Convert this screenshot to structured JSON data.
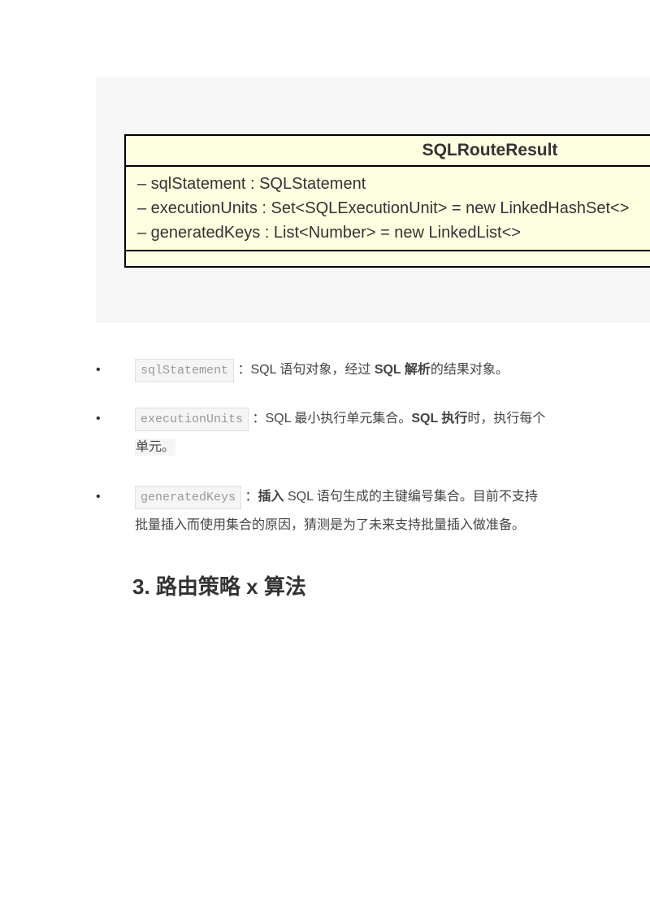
{
  "uml": {
    "className": "SQLRouteResult",
    "fields": [
      "– sqlStatement : SQLStatement",
      "– executionUnits : Set<SQLExecutionUnit> = new LinkedHashSet<>",
      "– generatedKeys : List<Number> = new LinkedList<>"
    ]
  },
  "items": [
    {
      "code": "sqlStatement",
      "text_before_bold": "：SQL 语句对象，经过 ",
      "bold": "SQL 解析",
      "text_after_bold": "的结果对象。",
      "continuation": ""
    },
    {
      "code": "executionUnits",
      "text_before_bold": "：SQL 最小执行单元集合。",
      "bold": "SQL 执行",
      "text_after_bold": "时，执行每个",
      "continuation": "单元。"
    },
    {
      "code": "generatedKeys",
      "text_before_bold": "：",
      "bold": "插入 ",
      "text_after_bold": "SQL 语句生成的主键编号集合。目前不支持",
      "continuation": "批量插入而使用集合的原因，猜测是为了未来支持批量插入做准备。"
    }
  ],
  "heading": "3. 路由策略 x 算法"
}
